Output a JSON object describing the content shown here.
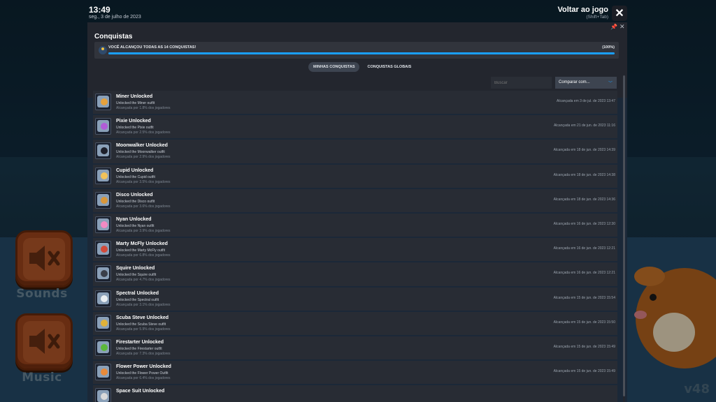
{
  "topbar": {
    "time": "13:49",
    "date": "seg., 3 de julho de 2023",
    "return_label": "Voltar ao jogo",
    "return_shortcut": "(Shift+Tab)"
  },
  "game": {
    "sounds_label": "Sounds",
    "music_label": "Music",
    "version": "v48"
  },
  "panel": {
    "title": "Conquistas",
    "summary_text": "VOCÊ ALCANÇOU TODAS AS 14 CONQUISTAS!",
    "summary_percent": "(100%)",
    "progress": 1.0,
    "tabs": [
      {
        "label": "MINHAS CONQUISTAS",
        "active": true
      },
      {
        "label": "CONQUISTAS GLOBAIS",
        "active": false
      }
    ],
    "search_placeholder": "Buscar",
    "compare_label": "Comparar com..."
  },
  "achievements": [
    {
      "name": "Miner Unlocked",
      "desc": "Unlocked the Miner outfit",
      "pct": "Alcançada por 1.8% dos jogadores",
      "date": "Alcançada em 3 de jul. de 2023 13:47",
      "color": "#e6a13c"
    },
    {
      "name": "Pixie Unlocked",
      "desc": "Unlocked the Pixie outfit",
      "pct": "Alcançada por 2.5% dos jogadores",
      "date": "Alcançada em 21 de jun. de 2023 11:16",
      "color": "#b05cd6"
    },
    {
      "name": "Moonwalker Unlocked",
      "desc": "Unlocked the Moonwalker outfit",
      "pct": "Alcançada por 2.9% dos jogadores",
      "date": "Alcançada em 18 de jun. de 2023 14:39",
      "color": "#1d1f2a"
    },
    {
      "name": "Cupid Unlocked",
      "desc": "Unlocked the Cupid outfit",
      "pct": "Alcançada por 3.5% dos jogadores",
      "date": "Alcançada em 18 de jun. de 2023 14:38",
      "color": "#f0c25a"
    },
    {
      "name": "Disco Unlocked",
      "desc": "Unlocked the Disco outfit",
      "pct": "Alcançada por 3.6% dos jogadores",
      "date": "Alcançada em 18 de jun. de 2023 14:36",
      "color": "#d9973a"
    },
    {
      "name": "Nyan Unlocked",
      "desc": "Unlocked the Nyan outfit",
      "pct": "Alcançada por 3.9% dos jogadores",
      "date": "Alcançada em 16 de jun. de 2023 12:30",
      "color": "#f28ac3"
    },
    {
      "name": "Marty McFly Unlocked",
      "desc": "Unlocked the Marty McFly outfit",
      "pct": "Alcançada por 6.8% dos jogadores",
      "date": "Alcançada em 16 de jun. de 2023 12:21",
      "color": "#d24a3a"
    },
    {
      "name": "Squire Unlocked",
      "desc": "Unlocked the Squire outfit",
      "pct": "Alcançada por 4.7% dos jogadores",
      "date": "Alcançada em 16 de jun. de 2023 12:21",
      "color": "#3a3f4a"
    },
    {
      "name": "Spectral Unlocked",
      "desc": "Unlocked the Spectral outfit",
      "pct": "Alcançada por 3.1% dos jogadores",
      "date": "Alcançada em 15 de jun. de 2023 15:54",
      "color": "#e9eef2"
    },
    {
      "name": "Scuba Steve Unlocked",
      "desc": "Unlocked the Scuba Steve outfit",
      "pct": "Alcançada por 5.9% dos jogadores",
      "date": "Alcançada em 15 de jun. de 2023 15:50",
      "color": "#e0b23a"
    },
    {
      "name": "Firestarter Unlocked",
      "desc": "Unlocked the Firestarter outfit",
      "pct": "Alcançada por 7.3% dos jogadores",
      "date": "Alcançada em 15 de jun. de 2023 15:49",
      "color": "#5cb83a"
    },
    {
      "name": "Flower Power Unlocked",
      "desc": "Unlocked the Flower Power Outfit",
      "pct": "Alcançada por 6.4% dos jogadores",
      "date": "Alcançada em 15 de jun. de 2023 15:49",
      "color": "#e88a3a"
    },
    {
      "name": "Space Suit Unlocked",
      "desc": "",
      "pct": "",
      "date": "",
      "color": "#d9d9d9"
    }
  ]
}
